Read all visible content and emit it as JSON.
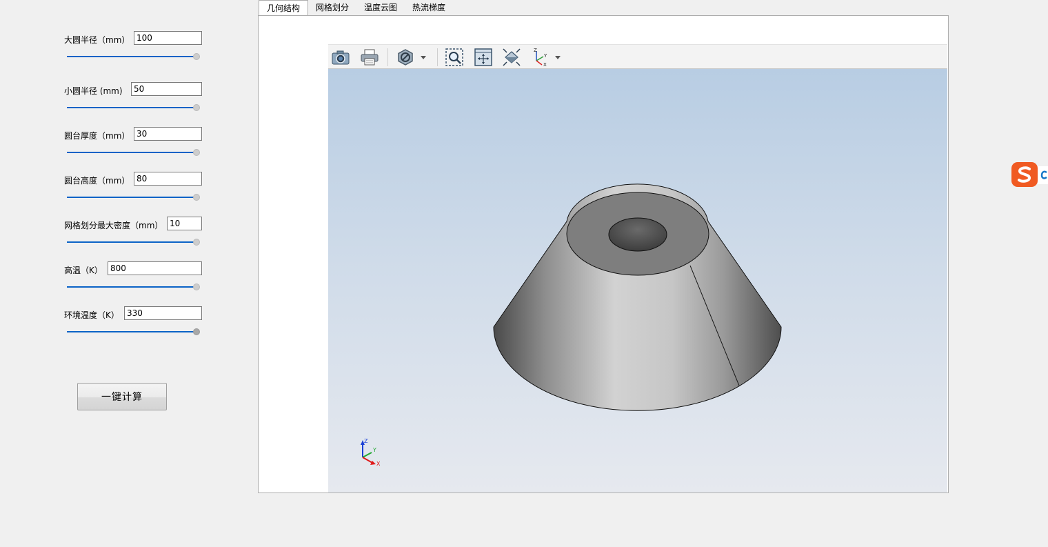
{
  "tabs": [
    {
      "label": "几何结构",
      "active": true
    },
    {
      "label": "网格划分",
      "active": false
    },
    {
      "label": "温度云图",
      "active": false
    },
    {
      "label": "热流梯度",
      "active": false
    }
  ],
  "params": {
    "large_radius": {
      "label": "大圆半径（mm）",
      "value": "100"
    },
    "small_radius": {
      "label": "小圆半径 (mm)",
      "value": "50"
    },
    "table_thickness": {
      "label": "圆台厚度（mm）",
      "value": "30"
    },
    "table_height": {
      "label": "圆台高度（mm）",
      "value": "80"
    },
    "mesh_density": {
      "label": "网格划分最大密度（mm）",
      "value": "10"
    },
    "high_temp": {
      "label": "高温（K）",
      "value": "800"
    },
    "ambient_temp": {
      "label": "环境温度（K）",
      "value": "330"
    }
  },
  "calc_button": {
    "label": "一键计算"
  },
  "viewer": {
    "toolbar_icons": [
      "camera-icon",
      "printer-icon",
      "display-mode-icon",
      "zoom-box-icon",
      "fit-all-icon",
      "view-fit-icon",
      "axis-view-icon"
    ],
    "triad": {
      "x": "X",
      "y": "Y",
      "z": "Z"
    },
    "toolbar_triad": {
      "x": "X",
      "y": "Y",
      "z": "Z"
    }
  },
  "colors": {
    "accent": "#0b63c7",
    "scene_top": "#b8cde3",
    "scene_bottom": "#e6e9ef",
    "ime_orange": "#f05a22"
  }
}
